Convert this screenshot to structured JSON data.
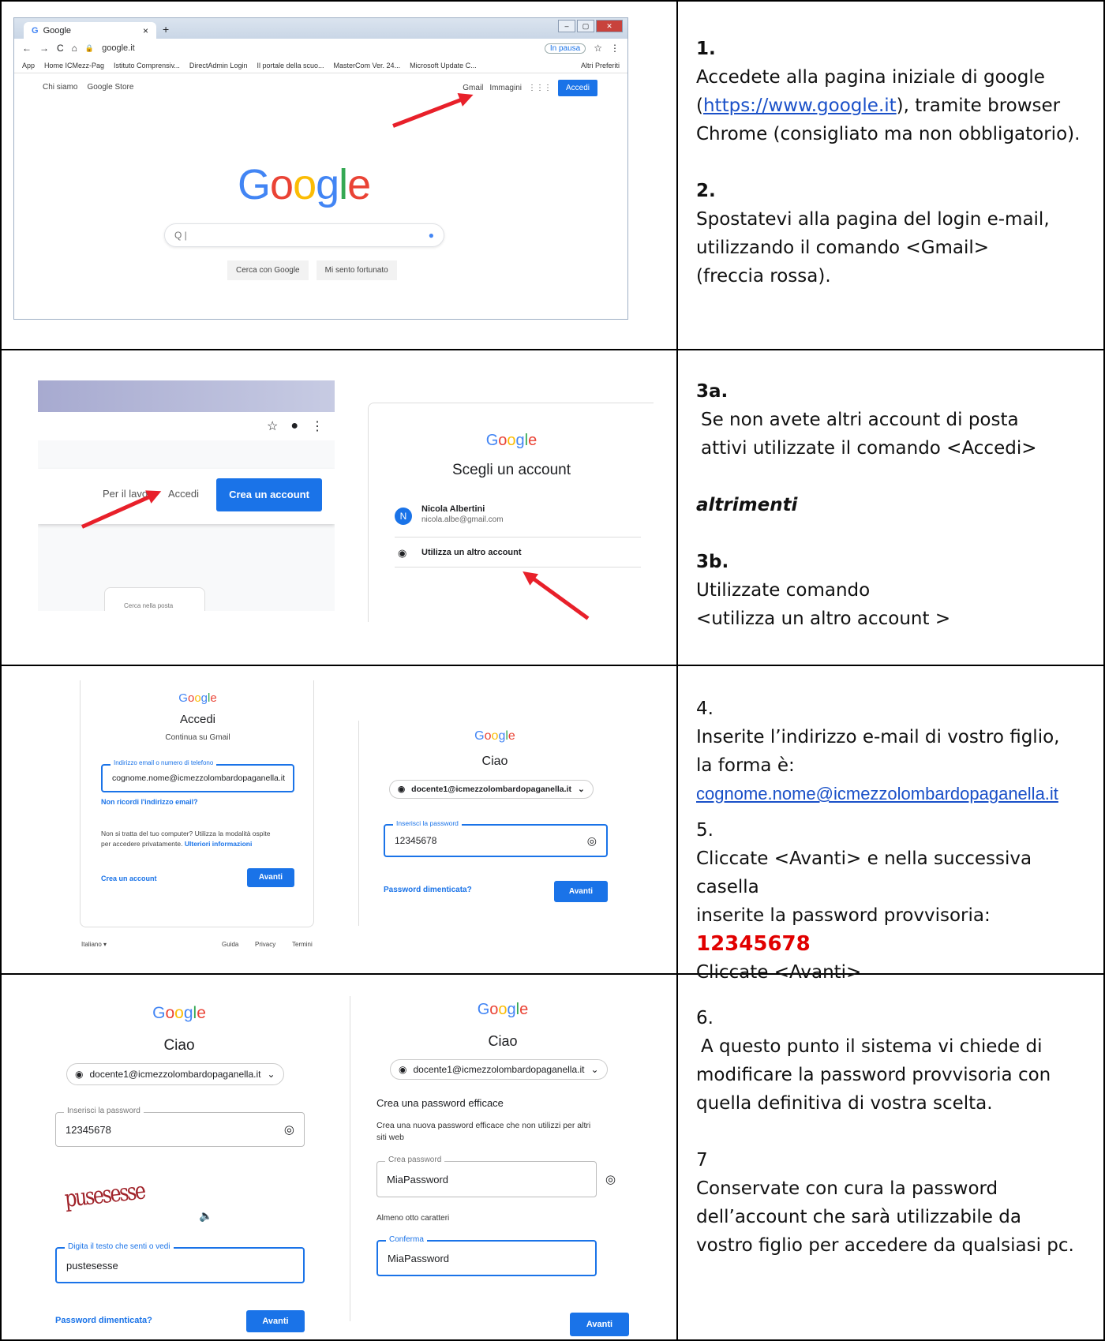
{
  "row1": {
    "browser": {
      "tab_title": "Google",
      "url": "google.it",
      "pause_label": "In pausa",
      "bookmarks": [
        "App",
        "Home ICMezz-Pag",
        "Istituto Comprensiv...",
        "DirectAdmin Login",
        "Il portale della scuo...",
        "MasterCom Ver. 24...",
        "Microsoft Update C...",
        "Altri Preferiti"
      ],
      "top_left_links": [
        "Chi siamo",
        "Google Store"
      ],
      "gmail": "Gmail",
      "images": "Immagini",
      "accedi": "Accedi",
      "logo": [
        "G",
        "o",
        "o",
        "g",
        "l",
        "e"
      ],
      "search_placeholder": "Q |",
      "btn_search": "Cerca con Google",
      "btn_lucky": "Mi sento fortunato"
    },
    "text": {
      "step1_num": "1.",
      "step1_a": "Accedete alla pagina iniziale di google",
      "step1_link": "https://www.google.it",
      "step1_b": "), tramite browser",
      "step1_c": "Chrome (consigliato ma non obbligatorio).",
      "step2_num": "2.",
      "step2_a": "Spostatevi alla pagina del login e-mail,",
      "step2_b": "utilizzando il comando <Gmail>",
      "step2_c": "(freccia rossa)."
    }
  },
  "row2": {
    "left": {
      "per_il_lavoro": "Per il lavoro",
      "accedi": "Accedi",
      "crea_account": "Crea un account",
      "phone_text": "Cerca nella posta"
    },
    "right": {
      "title": "Scegli un account",
      "acct_name": "Nicola Albertini",
      "acct_email": "nicola.albe@gmail.com",
      "acct_initial": "N",
      "other": "Utilizza un altro account"
    },
    "text": {
      "s3a": "3a.",
      "s3a_1": "Se non avete altri account di posta",
      "s3a_2": "attivi utilizzate il comando <Accedi>",
      "altrimenti": "altrimenti",
      "s3b": "3b.",
      "s3b_1": "Utilizzate comando",
      "s3b_2": "<utilizza un altro account >"
    }
  },
  "row3": {
    "left": {
      "title": "Accedi",
      "subtitle": "Continua su Gmail",
      "field_label": "Indirizzo email o numero di telefono",
      "field_value": "cognome.nome@icmezzolombardopaganella.it",
      "forgot": "Non ricordi l'indirizzo email?",
      "guest_1": "Non si tratta del tuo computer? Utilizza la modalità ospite",
      "guest_2": "per accedere privatamente.",
      "more_info": "Ulteriori informazioni",
      "create": "Crea un account",
      "next": "Avanti",
      "lang": "Italiano",
      "footer_help": "Guida",
      "footer_privacy": "Privacy",
      "footer_terms": "Termini"
    },
    "right": {
      "title": "Ciao",
      "account": "docente1@icmezzolombardopaganella.it",
      "field_label": "Inserisci la password",
      "field_value": "12345678",
      "forgot": "Password dimenticata?",
      "next": "Avanti"
    },
    "text": {
      "s4": "4.",
      "s4_1": "Inserite l’indirizzo e-mail di vostro figlio,",
      "s4_2": "la forma è:",
      "s4_link": "cognome.nome@icmezzolombardopaganella.it",
      "s5": "5.",
      "s5_1": "Cliccate <Avanti> e nella successiva casella",
      "s5_2": "inserite la password provvisoria:",
      "s5_pwd": "12345678",
      "s5_3": "Cliccate <Avanti>"
    }
  },
  "row4": {
    "left": {
      "title": "Ciao",
      "account": "docente1@icmezzolombardopaganella.it",
      "pwd_label": "Inserisci la password",
      "pwd_value": "12345678",
      "captcha": "pusesesse",
      "captcha_label": "Digita il testo che senti o vedi",
      "captcha_value": "pustesesse",
      "forgot": "Password dimenticata?",
      "next": "Avanti"
    },
    "right": {
      "title": "Ciao",
      "account": "docente1@icmezzolombardopaganella.it",
      "heading": "Crea una password efficace",
      "desc_1": "Crea una nuova password efficace che non utilizzi per altri",
      "desc_2": "siti web",
      "new_label": "Crea password",
      "new_value": "MiaPassword",
      "hint": "Almeno otto caratteri",
      "confirm_label": "Conferma",
      "confirm_value": "MiaPassword",
      "next": "Avanti"
    },
    "text": {
      "s6": "6.",
      "s6_1": "A questo punto il sistema vi chiede di",
      "s6_2": "modificare la password provvisoria con",
      "s6_3": "quella definitiva di vostra scelta.",
      "s7": "7",
      "s7_1": "Conservate con cura la password",
      "s7_2": "dell’account che sarà utilizzabile da",
      "s7_3": "vostro figlio per accedere da qualsiasi pc."
    }
  },
  "google_word": [
    "G",
    "o",
    "o",
    "g",
    "l",
    "e"
  ]
}
